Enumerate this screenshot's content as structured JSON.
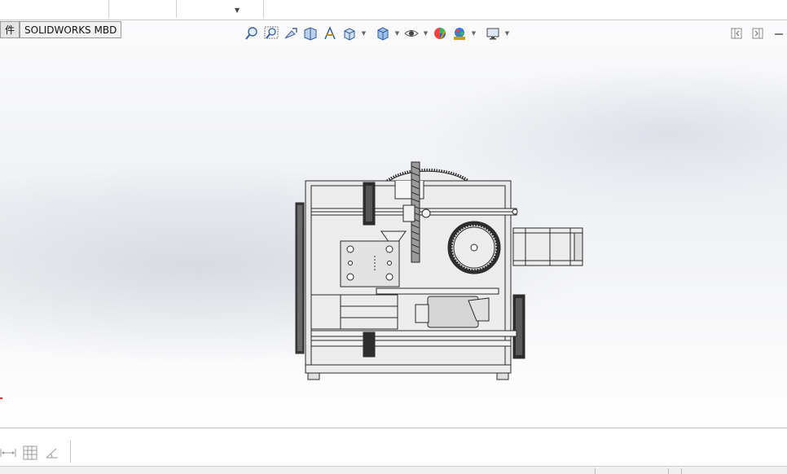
{
  "window": {
    "tabs": [
      {
        "label": "件",
        "active": false
      },
      {
        "label": "SOLIDWORKS MBD",
        "active": true
      }
    ]
  },
  "heads_up_toolbar": {
    "buttons": [
      {
        "icon": "zoom-to-fit-icon",
        "dropdown": false
      },
      {
        "icon": "zoom-to-area-icon",
        "dropdown": false
      },
      {
        "icon": "previous-view-icon",
        "dropdown": false
      },
      {
        "icon": "section-view-icon",
        "dropdown": false
      },
      {
        "icon": "dynamic-annotation-view-icon",
        "dropdown": false
      },
      {
        "icon": "view-orientation-icon",
        "dropdown": true
      },
      {
        "icon": "display-style-icon",
        "dropdown": true
      },
      {
        "icon": "hide-show-items-icon",
        "dropdown": true
      },
      {
        "icon": "edit-appearance-icon",
        "dropdown": false
      },
      {
        "icon": "apply-scene-icon",
        "dropdown": true
      },
      {
        "icon": "view-settings-icon",
        "dropdown": true
      }
    ]
  },
  "view_controls": [
    {
      "icon": "split-view-left-icon"
    },
    {
      "icon": "split-view-right-icon"
    },
    {
      "icon": "minimize-icon"
    }
  ],
  "sketch_toolbar": [
    {
      "icon": "dimension-icon"
    },
    {
      "icon": "grid-icon"
    },
    {
      "icon": "angle-icon"
    }
  ],
  "colors": {
    "accent_red": "#d22222",
    "model_fill": "#e6e6e6",
    "model_line": "#2a2a2a"
  }
}
